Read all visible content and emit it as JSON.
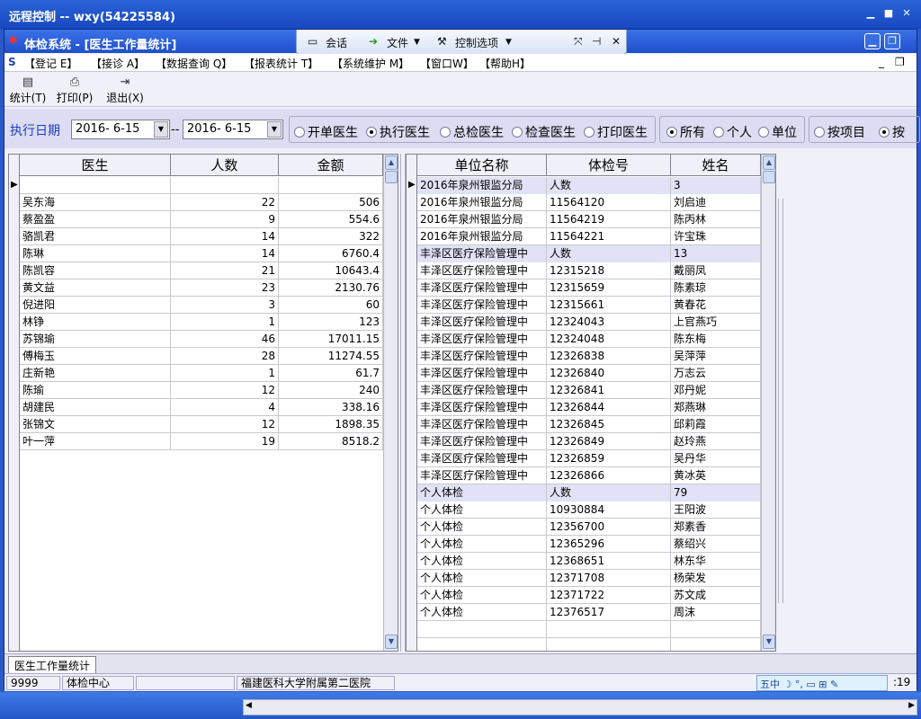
{
  "outer_window": {
    "title": "远程控制 -- wxy(54225584)"
  },
  "app": {
    "title": "体检系统 - [医生工作量统计]",
    "remote_bar": {
      "chat": "会话",
      "file": "文件",
      "options": "控制选项"
    }
  },
  "menu": [
    "【登记 E】",
    "【接诊 A】",
    "【数据查询 Q】",
    "【报表统计 T】",
    "【系统维护 M】",
    "【窗口W】",
    "【帮助H】"
  ],
  "toolbar": {
    "stat": "统计(T)",
    "print": "打印(P)",
    "exit": "退出(X)"
  },
  "filter": {
    "date_label": "执行日期",
    "date_from": "2016- 6-15",
    "date_sep": "--",
    "date_to": "2016- 6-15",
    "doctor_types": [
      "开单医生",
      "执行医生",
      "总检医生",
      "检查医生",
      "打印医生"
    ],
    "doctor_type_selected": "执行医生",
    "scope": [
      "所有",
      "个人",
      "单位"
    ],
    "scope_selected": "所有",
    "mode": [
      "按项目",
      "按"
    ],
    "mode_selected": "按"
  },
  "left_grid": {
    "headers": [
      "医生",
      "人数",
      "金额"
    ],
    "rows": [
      [
        "",
        "",
        ""
      ],
      [
        "吴东海",
        "22",
        "506"
      ],
      [
        "蔡盈盈",
        "9",
        "554.6"
      ],
      [
        "骆凯君",
        "14",
        "322"
      ],
      [
        "陈琳",
        "14",
        "6760.4"
      ],
      [
        "陈凯容",
        "21",
        "10643.4"
      ],
      [
        "黄文益",
        "23",
        "2130.76"
      ],
      [
        "倪进阳",
        "3",
        "60"
      ],
      [
        "林铮",
        "1",
        "123"
      ],
      [
        "苏锦瑜",
        "46",
        "17011.15"
      ],
      [
        "傅梅玉",
        "28",
        "11274.55"
      ],
      [
        "庄新艳",
        "1",
        "61.7"
      ],
      [
        "陈瑜",
        "12",
        "240"
      ],
      [
        "胡建民",
        "4",
        "338.16"
      ],
      [
        "张锦文",
        "12",
        "1898.35"
      ],
      [
        "叶一萍",
        "19",
        "8518.2"
      ]
    ]
  },
  "right_grid": {
    "headers": [
      "单位名称",
      "体检号",
      "姓名"
    ],
    "rows": [
      [
        "2016年泉州银监分局",
        "人数",
        "3"
      ],
      [
        "2016年泉州银监分局",
        "11564120",
        "刘启迪"
      ],
      [
        "2016年泉州银监分局",
        "11564219",
        "陈丙林"
      ],
      [
        "2016年泉州银监分局",
        "11564221",
        "许宝珠"
      ],
      [
        "丰泽区医疗保险管理中",
        "人数",
        "13"
      ],
      [
        "丰泽区医疗保险管理中",
        "12315218",
        "戴丽凤"
      ],
      [
        "丰泽区医疗保险管理中",
        "12315659",
        "陈素琼"
      ],
      [
        "丰泽区医疗保险管理中",
        "12315661",
        "黄春花"
      ],
      [
        "丰泽区医疗保险管理中",
        "12324043",
        "上官燕巧"
      ],
      [
        "丰泽区医疗保险管理中",
        "12324048",
        "陈东梅"
      ],
      [
        "丰泽区医疗保险管理中",
        "12326838",
        "吴萍萍"
      ],
      [
        "丰泽区医疗保险管理中",
        "12326840",
        "万志云"
      ],
      [
        "丰泽区医疗保险管理中",
        "12326841",
        "邓丹妮"
      ],
      [
        "丰泽区医疗保险管理中",
        "12326844",
        "郑燕琳"
      ],
      [
        "丰泽区医疗保险管理中",
        "12326845",
        "邱莉霞"
      ],
      [
        "丰泽区医疗保险管理中",
        "12326849",
        "赵玲燕"
      ],
      [
        "丰泽区医疗保险管理中",
        "12326859",
        "吴丹华"
      ],
      [
        "丰泽区医疗保险管理中",
        "12326866",
        "黄冰英"
      ],
      [
        "个人体检",
        "人数",
        "79"
      ],
      [
        "个人体检",
        "10930884",
        "王阳波"
      ],
      [
        "个人体检",
        "12356700",
        "郑素香"
      ],
      [
        "个人体检",
        "12365296",
        "蔡绍兴"
      ],
      [
        "个人体检",
        "12368651",
        "林东华"
      ],
      [
        "个人体检",
        "12371708",
        "杨荣发"
      ],
      [
        "个人体检",
        "12371722",
        "苏文成"
      ],
      [
        "个人体检",
        "12376517",
        "周沫"
      ],
      [
        "",
        "",
        ""
      ],
      [
        "",
        "",
        ""
      ]
    ]
  },
  "tab": "医生工作量统计",
  "status": {
    "user_id": "9999",
    "dept": "体检中心",
    "hospital": "福建医科大学附属第二医院",
    "ime": "五中",
    "time": ":19"
  }
}
